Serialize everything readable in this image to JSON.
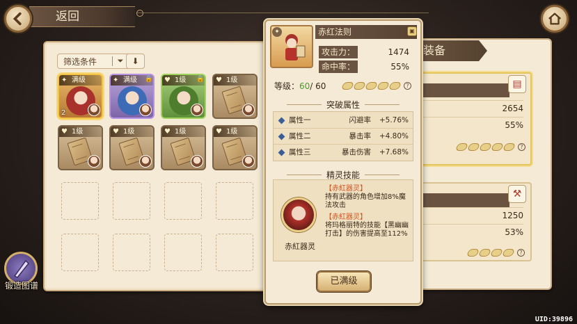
{
  "header": {
    "back_label": "返回"
  },
  "inventory": {
    "filter_label": "筛选条件",
    "items": [
      {
        "level": "满级",
        "rarity": "gold",
        "count": "2",
        "locked": false,
        "art": "portrait-red"
      },
      {
        "level": "满级",
        "rarity": "purple",
        "count": "",
        "locked": true,
        "art": "portrait-blue"
      },
      {
        "level": "1级",
        "rarity": "green",
        "count": "",
        "locked": true,
        "art": "portrait-green"
      },
      {
        "level": "1级",
        "rarity": "plain",
        "count": "",
        "locked": false,
        "art": "book"
      },
      {
        "level": "1级",
        "rarity": "plain",
        "count": "",
        "locked": false,
        "art": "book"
      },
      {
        "level": "1级",
        "rarity": "plain",
        "count": "",
        "locked": false,
        "art": "book"
      },
      {
        "level": "1级",
        "rarity": "plain",
        "count": "",
        "locked": false,
        "art": "book"
      },
      {
        "level": "1级",
        "rarity": "plain",
        "count": "",
        "locked": false,
        "art": "book"
      }
    ]
  },
  "equip_panel": {
    "title": "装备",
    "top_card": {
      "stat1": "2654",
      "stat2": "55%"
    },
    "bottom_card": {
      "stat1": "1250",
      "stat2": "53%"
    }
  },
  "detail": {
    "name": "赤红法则",
    "attack_label": "攻击力：",
    "attack_value": "1474",
    "hit_label": "命中率：",
    "hit_value": "55%",
    "level_label": "等级：",
    "level_current": "60",
    "level_max": "/ 60",
    "breakthrough_title": "突破属性",
    "attributes": [
      {
        "name": "属性一",
        "type": "闪避率",
        "value": "+5.76%"
      },
      {
        "name": "属性二",
        "type": "暴击率",
        "value": "+4.80%"
      },
      {
        "name": "属性三",
        "type": "暴击伤害",
        "value": "+7.68%"
      }
    ],
    "spirit_title": "精灵技能",
    "spirit_name": "赤紅器灵",
    "skill1_tag": "【赤紅器灵】",
    "skill1_text": "持有武器的角色增加8%魔法攻击",
    "skill2_tag": "【赤紅器灵】",
    "skill2_text": "将玛格丽特的技能【黑幽幽打击】的伤害提高至112%",
    "maxed_label": "已满级"
  },
  "forge_label": "锻造图谱",
  "uid": "UID:39896",
  "colors": {
    "accent_brown": "#6b5341",
    "panel_bg": "#f4ead6",
    "highlight_gold": "#f4c343",
    "level_green": "#4a9a2e"
  }
}
